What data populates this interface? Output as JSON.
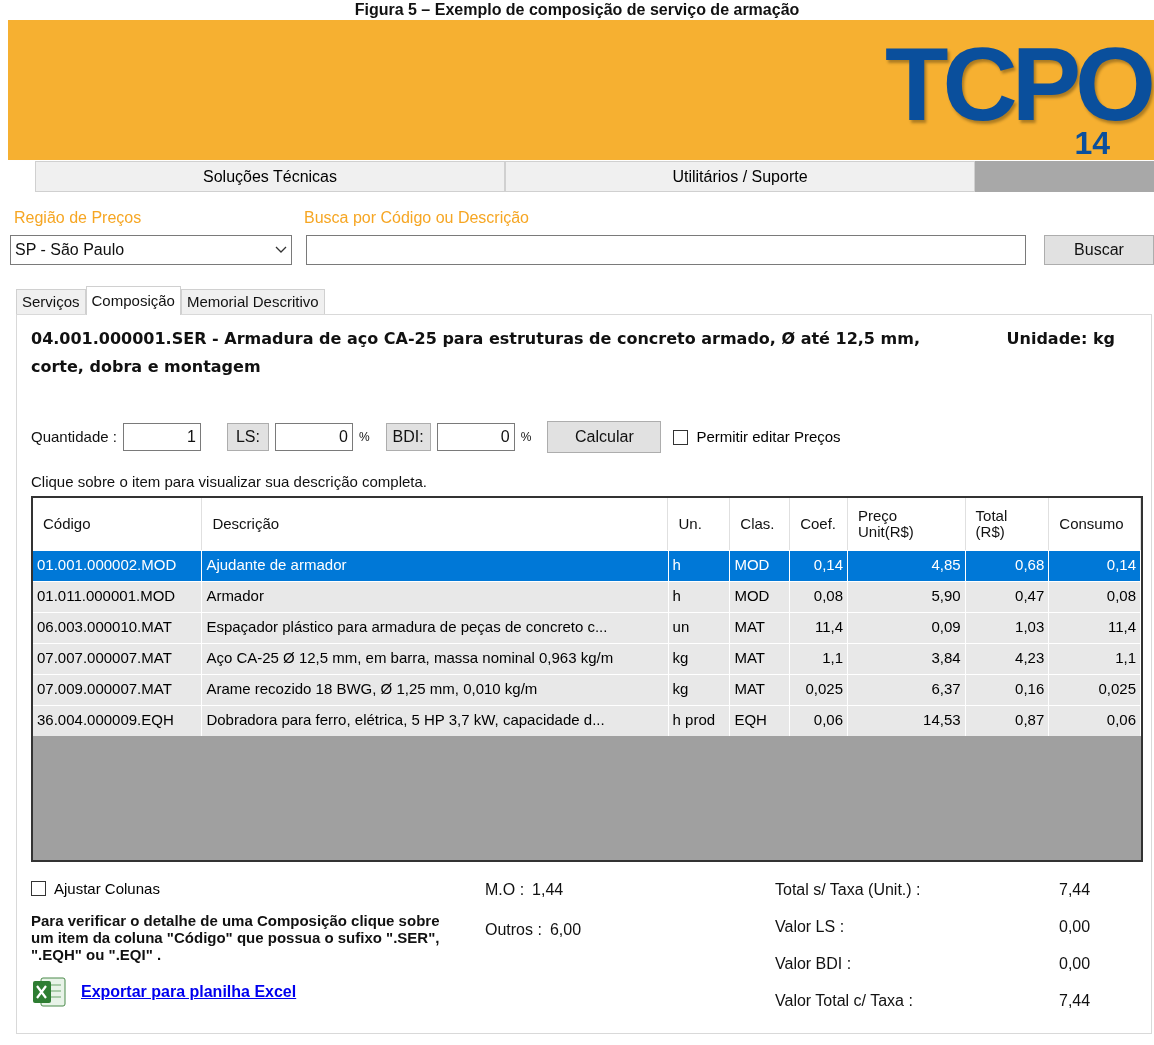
{
  "caption": "Figura 5 – Exemplo de composição de serviço de armação",
  "banner": {
    "logo": "TCPO",
    "logo_version": "14"
  },
  "menu": [
    {
      "label": "Soluções Técnicas"
    },
    {
      "label": "Utilitários / Suporte"
    }
  ],
  "search": {
    "region_label": "Região de Preços",
    "region_value": "SP - São Paulo",
    "query_label": "Busca por Código ou Descrição",
    "button": "Buscar"
  },
  "tabs": [
    {
      "label": "Serviços",
      "selected": false
    },
    {
      "label": "Composição",
      "selected": true
    },
    {
      "label": "Memorial Descritivo",
      "selected": false
    }
  ],
  "composition": {
    "title": "04.001.000001.SER - Armadura de aço CA-25 para estruturas de concreto armado, Ø até 12,5 mm, corte, dobra e montagem",
    "unit": "Unidade: kg"
  },
  "controls": {
    "quantity_label": "Quantidade :",
    "quantity": "1",
    "ls_label": "LS:",
    "ls": "0",
    "ls_pct": "%",
    "bdi_label": "BDI:",
    "bdi": "0",
    "bdi_pct": "%",
    "calc_button": "Calcular",
    "edit_prices": {
      "label": "Permitir editar Preços",
      "checked": false
    }
  },
  "hint": "Clique sobre o item para visualizar sua descrição completa.",
  "table": {
    "columns": [
      "Código",
      "Descrição",
      "Un.",
      "Clas.",
      "Coef.",
      "Preço Unit(R$)",
      "Total (R$)",
      "Consumo"
    ],
    "rows": [
      {
        "selected": true,
        "cells": [
          "01.001.000002.MOD",
          "Ajudante de armador",
          "h",
          "MOD",
          "0,14",
          "4,85",
          "0,68",
          "0,14"
        ]
      },
      {
        "selected": false,
        "cells": [
          "01.011.000001.MOD",
          "Armador",
          "h",
          "MOD",
          "0,08",
          "5,90",
          "0,47",
          "0,08"
        ]
      },
      {
        "selected": false,
        "cells": [
          "06.003.000010.MAT",
          "Espaçador plástico para armadura de peças de concreto c...",
          "un",
          "MAT",
          "11,4",
          "0,09",
          "1,03",
          "11,4"
        ]
      },
      {
        "selected": false,
        "cells": [
          "07.007.000007.MAT",
          "Aço CA-25 Ø 12,5 mm, em barra, massa nominal 0,963 kg/m",
          "kg",
          "MAT",
          "1,1",
          "3,84",
          "4,23",
          "1,1"
        ]
      },
      {
        "selected": false,
        "cells": [
          "07.009.000007.MAT",
          "Arame recozido 18 BWG, Ø 1,25 mm, 0,010 kg/m",
          "kg",
          "MAT",
          "0,025",
          "6,37",
          "0,16",
          "0,025"
        ]
      },
      {
        "selected": false,
        "cells": [
          "36.004.000009.EQH",
          "Dobradora para ferro, elétrica, 5 HP 3,7 kW, capacidade d...",
          "h prod",
          "EQH",
          "0,06",
          "14,53",
          "0,87",
          "0,06"
        ]
      }
    ]
  },
  "footer": {
    "adjust_columns": {
      "label": "Ajustar Colunas",
      "checked": false
    },
    "note": "Para verificar o detalhe de uma Composição clique sobre um item da coluna \"Código\" que possua o sufixo \".SER\", \".EQH\" ou \".EQI\" .",
    "export_link": "Exportar para planilha Excel",
    "mo": {
      "label": "M.O :",
      "value": "1,44"
    },
    "outros": {
      "label": "Outros :",
      "value": "6,00"
    },
    "totals": [
      {
        "label": "Total s/ Taxa (Unit.) :",
        "value": "7,44"
      },
      {
        "label": "Valor LS :",
        "value": "0,00"
      },
      {
        "label": "Valor BDI :",
        "value": "0,00"
      },
      {
        "label": "Valor Total c/ Taxa :",
        "value": "7,44"
      }
    ]
  }
}
